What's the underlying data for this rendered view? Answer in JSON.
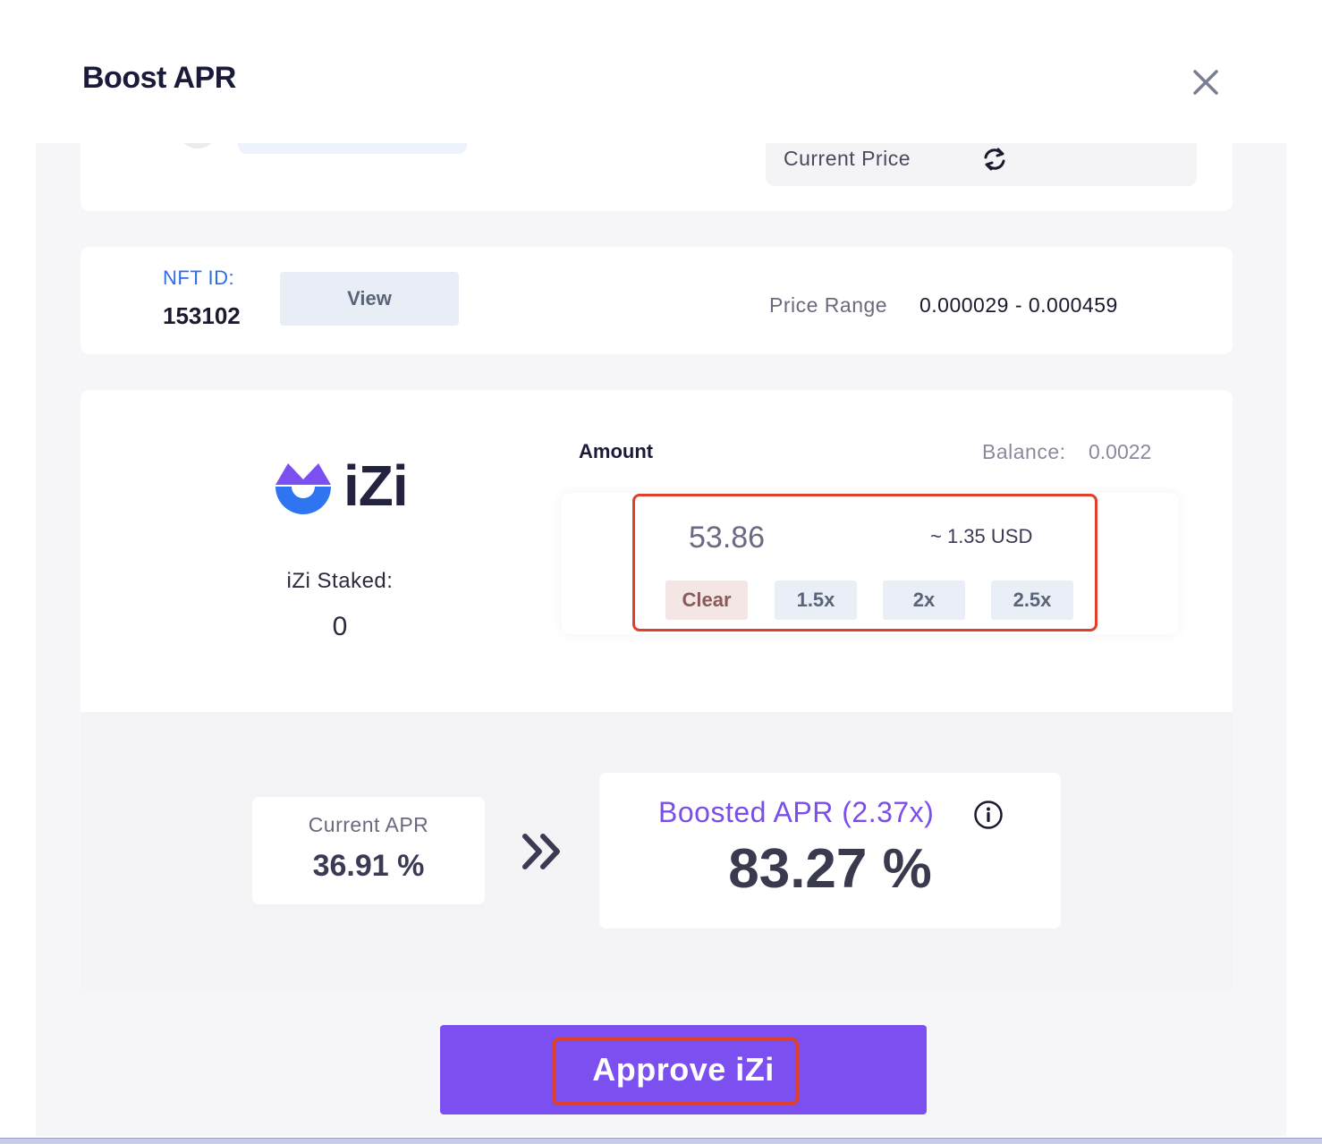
{
  "modal": {
    "title": "Boost APR"
  },
  "price": {
    "current_price_label": "Current Price"
  },
  "nft": {
    "id_label": "NFT ID:",
    "id_value": "153102",
    "view_label": "View",
    "price_range_label": "Price Range",
    "price_range_value": "0.000029 - 0.000459"
  },
  "stake": {
    "token_name": "iZi",
    "staked_label": "iZi Staked:",
    "staked_value": "0",
    "amount_label": "Amount",
    "balance_label": "Balance:",
    "balance_value": "0.0022",
    "amount_value": "53.86",
    "usd_value": "~ 1.35 USD",
    "buttons": [
      "Clear",
      "1.5x",
      "2x",
      "2.5x"
    ]
  },
  "apr": {
    "current_label": "Current APR",
    "current_value": "36.91 %",
    "boosted_label": "Boosted APR (2.37x)",
    "boosted_value": "83.27 %"
  },
  "actions": {
    "approve_label": "Approve iZi"
  },
  "colors": {
    "accent": "#7b4ff0",
    "link_blue": "#2b6ee8",
    "highlight_red": "#e0402a",
    "boosted_purple": "#7b4dea"
  },
  "icons": {
    "close": "close-icon",
    "refresh": "refresh-icon",
    "info": "info-icon",
    "arrows": "double-chevron-right-icon",
    "logo": "izi-logo-icon"
  }
}
